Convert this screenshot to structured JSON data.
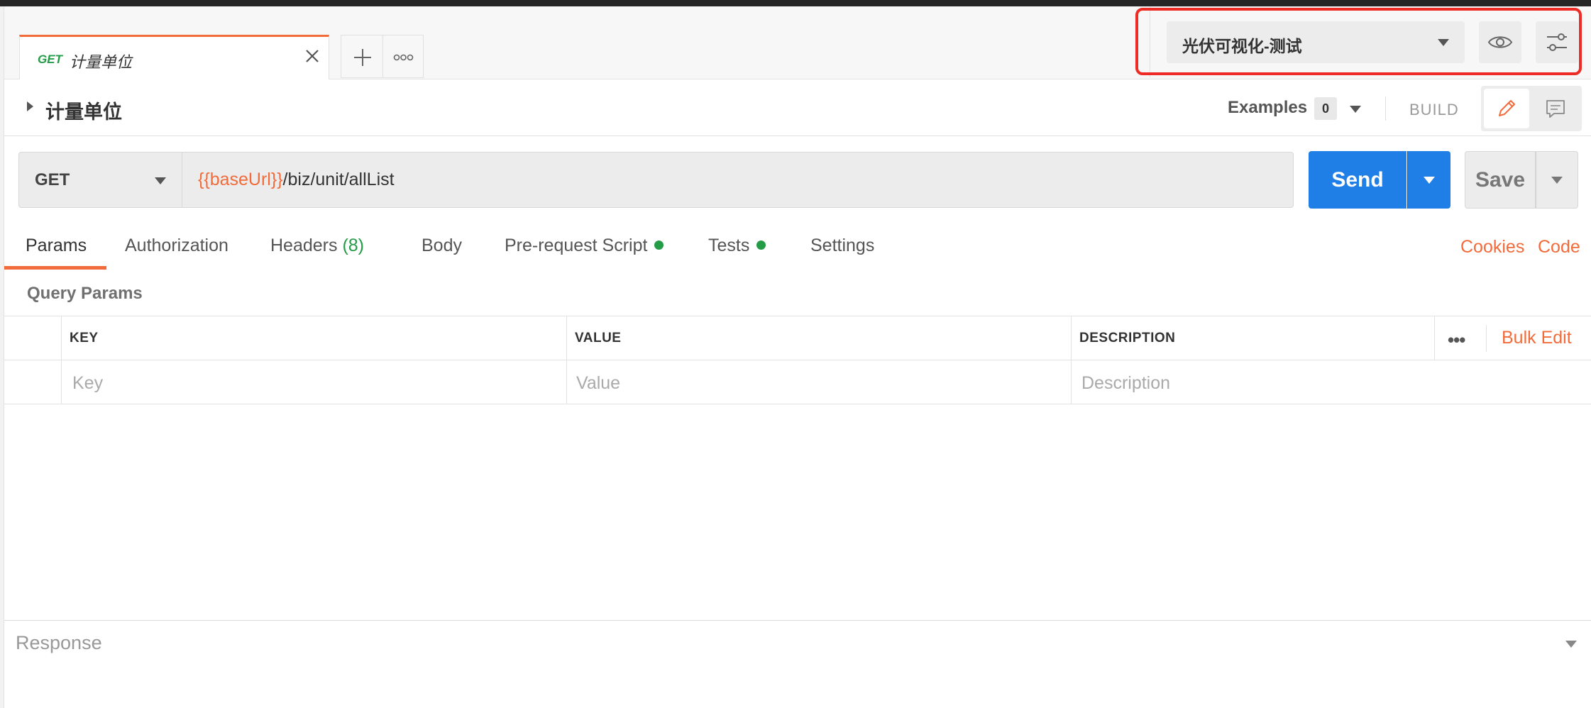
{
  "request_tab": {
    "method": "GET",
    "name": "计量单位"
  },
  "environment": {
    "selected": "光伏可视化-测试"
  },
  "request": {
    "title": "计量单位",
    "examples_label": "Examples",
    "examples_count": "0",
    "build_label": "BUILD",
    "method": "GET",
    "url_variable": "{{baseUrl}}",
    "url_path": "/biz/unit/allList",
    "send_label": "Send",
    "save_label": "Save"
  },
  "tabs": [
    {
      "label": "Params"
    },
    {
      "label": "Authorization"
    },
    {
      "label": "Headers",
      "count": "(8)"
    },
    {
      "label": "Body"
    },
    {
      "label": "Pre-request Script"
    },
    {
      "label": "Tests"
    },
    {
      "label": "Settings"
    }
  ],
  "links": {
    "cookies": "Cookies",
    "code": "Code"
  },
  "query_params": {
    "title": "Query Params",
    "headers": {
      "key": "KEY",
      "value": "VALUE",
      "description": "DESCRIPTION"
    },
    "more": "•••",
    "bulk_edit": "Bulk Edit",
    "placeholders": {
      "key": "Key",
      "value": "Value",
      "description": "Description"
    }
  },
  "response": {
    "label": "Response"
  },
  "colors": {
    "accent": "#f26b3a",
    "primary": "#1f7fe6",
    "success": "#249c47",
    "highlight": "#ee2b24"
  }
}
